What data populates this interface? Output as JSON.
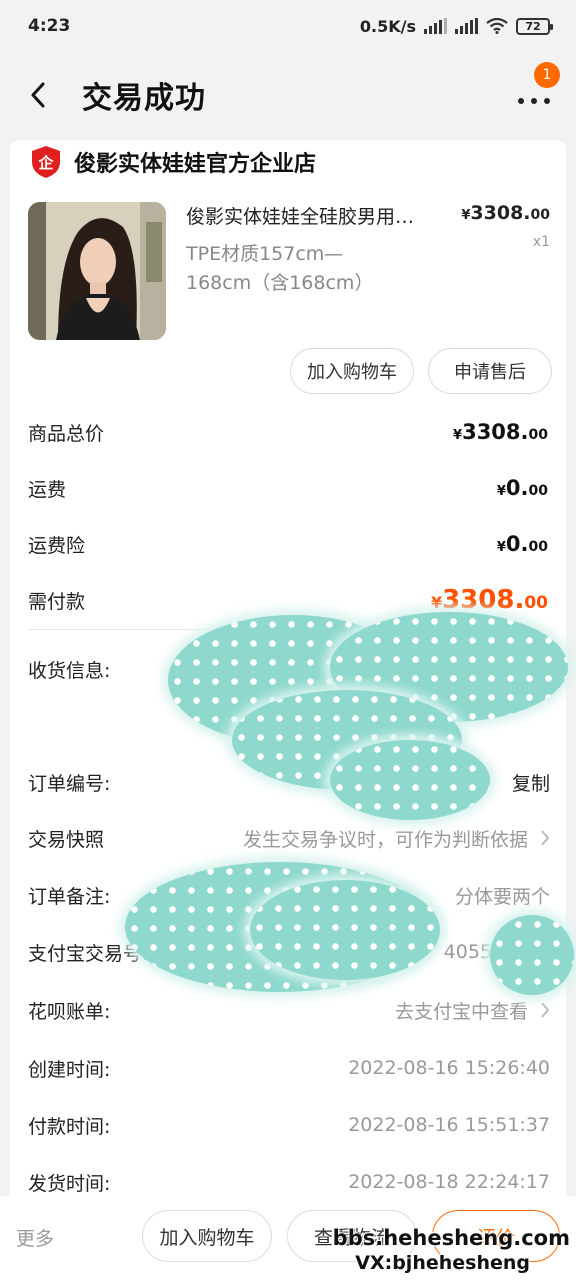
{
  "status_bar": {
    "time": "4:23",
    "network_speed": "0.5K/s",
    "battery": "72"
  },
  "nav": {
    "title": "交易成功",
    "badge_count": "1"
  },
  "shop": {
    "name": "俊影实体娃娃官方企业店",
    "icon": "enterprise-shop-icon",
    "icon_char": "企"
  },
  "product": {
    "title": "俊影实体娃娃全硅胶男用…",
    "spec_line1": "TPE材质157cm—",
    "spec_line2": "168cm（含168cm）",
    "price_symbol": "¥",
    "price_int": "3308.",
    "price_dec": "00",
    "qty": "x1"
  },
  "item_actions": {
    "add_cart": "加入购物车",
    "after_sale": "申请售后"
  },
  "price_summary": {
    "total_label": "商品总价",
    "total_int": "3308.",
    "total_dec": "00",
    "shipping_label": "运费",
    "shipping_int": "0.",
    "shipping_dec": "00",
    "insurance_label": "运费险",
    "insurance_int": "0.",
    "insurance_dec": "00",
    "payable_label": "需付款",
    "payable_int": "3308.",
    "payable_dec": "00",
    "currency": "¥"
  },
  "order_info": {
    "shipping_info_label": "收货信息:",
    "order_no_label": "订单编号:",
    "copy_label": "复制",
    "snapshot_label": "交易快照",
    "snapshot_value": "发生交易争议时，可作为判断依据",
    "remark_label": "订单备注:",
    "remark_value": "分体要两个",
    "alipay_label": "支付宝交易号:",
    "alipay_value": "4055",
    "huabei_label": "花呗账单:",
    "huabei_value": "去支付宝中查看",
    "created_label": "创建时间:",
    "created_value": "2022-08-16 15:26:40",
    "paid_label": "付款时间:",
    "paid_value": "2022-08-16 15:51:37",
    "shipped_label": "发货时间:",
    "shipped_value": "2022-08-18 22:24:17"
  },
  "bottom_bar": {
    "more": "更多",
    "add_cart": "加入购物车",
    "logistics": "查看物流",
    "evaluate": "评价"
  },
  "watermark": {
    "line1": "bbs.hehesheng.com",
    "line2": "VX:bjhehesheng"
  },
  "colors": {
    "accent": "#ff6a00",
    "price_orange": "#ff5000",
    "shop_icon_red": "#e02020",
    "redaction": "#8ed8cd"
  }
}
